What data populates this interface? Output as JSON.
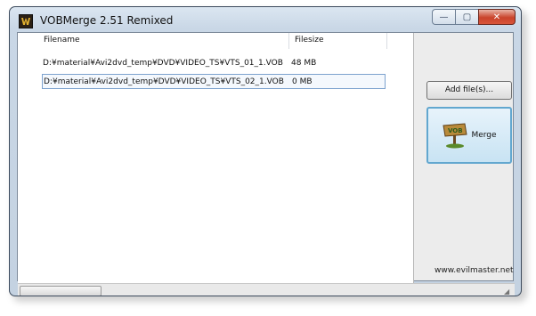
{
  "window": {
    "title": "VOBMerge 2.51 Remixed"
  },
  "caption_buttons": {
    "minimize": "—",
    "maximize": "▢",
    "close": "✕"
  },
  "file_list": {
    "columns": [
      "Filename",
      "Filesize"
    ],
    "rows": [
      {
        "filename": "D:¥material¥Avi2dvd_temp¥DVD¥VIDEO_TS¥VTS_01_1.VOB",
        "filesize": "48 MB"
      },
      {
        "filename": "D:¥material¥Avi2dvd_temp¥DVD¥VIDEO_TS¥VTS_02_1.VOB",
        "filesize": "0 MB"
      }
    ],
    "selected_row": 1
  },
  "buttons": {
    "add_files": "Add file(s)...",
    "merge": "Merge"
  },
  "merge_icon_text": "VOB",
  "website": "www.evilmaster.net",
  "colors": {
    "titlebar": "#c9d7e6",
    "close_button": "#c9432b",
    "selection_border": "#7da2ce",
    "merge_focus": "#62a7cf"
  },
  "icons": {
    "app": "vob-merge-app-icon",
    "merge": "vob-sign-icon"
  }
}
